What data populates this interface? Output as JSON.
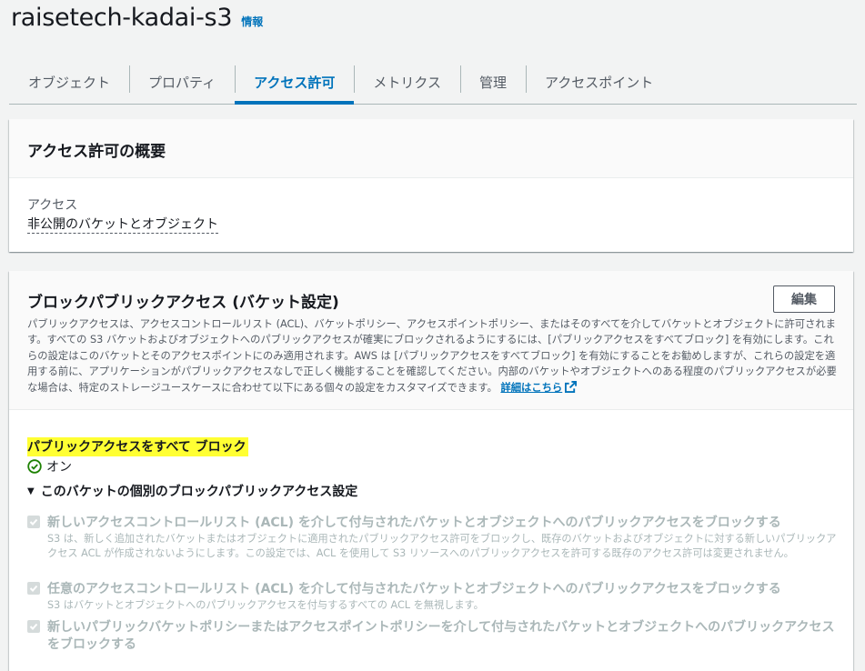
{
  "header": {
    "title": "raisetech-kadai-s3",
    "info": "情報"
  },
  "tabs": [
    {
      "label": "オブジェクト",
      "active": false
    },
    {
      "label": "プロパティ",
      "active": false
    },
    {
      "label": "アクセス許可",
      "active": true
    },
    {
      "label": "メトリクス",
      "active": false
    },
    {
      "label": "管理",
      "active": false
    },
    {
      "label": "アクセスポイント",
      "active": false
    }
  ],
  "overview": {
    "title": "アクセス許可の概要",
    "access_label": "アクセス",
    "access_value": "非公開のバケットとオブジェクト"
  },
  "block_public": {
    "title": "ブロックパブリックアクセス (バケット設定)",
    "edit_label": "編集",
    "description": "パブリックアクセスは、アクセスコントロールリスト (ACL)、バケットポリシー、アクセスポイントポリシー、またはそのすべてを介してバケットとオブジェクトに許可されます。すべての S3 バケットおよびオブジェクトへのパブリックアクセスが確実にブロックされるようにするには、[パブリックアクセスをすべてブロック] を有効にします。これらの設定はこのバケットとそのアクセスポイントにのみ適用されます。AWS は [パブリックアクセスをすべてブロック] を有効にすることをお勧めしますが、これらの設定を適用する前に、アプリケーションがパブリックアクセスなしで正しく機能することを確認してください。内部のバケットやオブジェクトへのある程度のパブリックアクセスが必要な場合は、特定のストレージユースケースに合わせて以下にある個々の設定をカスタマイズできます。",
    "learn_more": "詳細はこちら",
    "block_all_label": "パブリックアクセスをすべて ブロック",
    "status": "オン",
    "expander": "このバケットの個別のブロックパブリックアクセス設定",
    "options": [
      {
        "title": "新しいアクセスコントロールリスト (ACL) を介して付与されたバケットとオブジェクトへのパブリックアクセスをブロックする",
        "desc": "S3 は、新しく追加されたバケットまたはオブジェクトに適用されたパブリックアクセス許可をブロックし、既存のバケットおよびオブジェクトに対する新しいパブリックアクセス ACL が作成されないようにします。この設定では、ACL を使用して S3 リソースへのパブリックアクセスを許可する既存のアクセス許可は変更されません。"
      },
      {
        "title": "任意のアクセスコントロールリスト (ACL) を介して付与されたバケットとオブジェクトへのパブリックアクセスをブロックする",
        "desc": "S3 はバケットとオブジェクトへのパブリックアクセスを付与するすべての ACL を無視します。"
      },
      {
        "title": "新しいパブリックバケットポリシーまたはアクセスポイントポリシーを介して付与されたバケットとオブジェクトへのパブリックアクセスをブロックする",
        "desc": ""
      }
    ]
  },
  "colors": {
    "accent": "#0073bb",
    "success": "#1d8102",
    "highlight": "#ffff33",
    "disabled": "#aab7b8"
  }
}
